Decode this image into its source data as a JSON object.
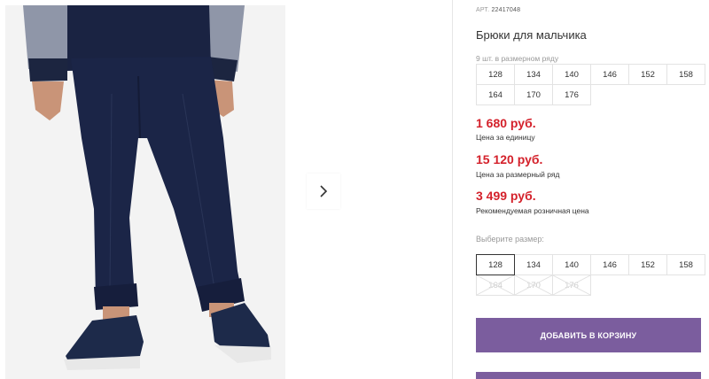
{
  "product": {
    "article_label": "АРТ.",
    "article_number": "22417048",
    "title": "Брюки для мальчика",
    "size_count_text": "9 шт. в размерном ряду",
    "size_row": [
      "128",
      "134",
      "140",
      "146",
      "152",
      "158",
      "164",
      "170",
      "176"
    ]
  },
  "prices": [
    {
      "value": "1 680 руб.",
      "label": "Цена за единицу"
    },
    {
      "value": "15 120 руб.",
      "label": "Цена за размерный ряд"
    },
    {
      "value": "3 499 руб.",
      "label": "Рекомендуемая розничная цена"
    }
  ],
  "size_select": {
    "label": "Выберите размер:",
    "options": [
      "128",
      "134",
      "140",
      "146",
      "152",
      "158",
      "164",
      "170",
      "176"
    ],
    "selected": "128",
    "unavailable": [
      "164",
      "170",
      "176"
    ]
  },
  "actions": {
    "add_to_cart": "ДОБАВИТЬ В КОРЗИНУ"
  },
  "colors": {
    "price_red": "#d4212b",
    "button_purple": "#7b5d9e"
  },
  "gallery": {
    "next_icon": "chevron-right-icon"
  }
}
